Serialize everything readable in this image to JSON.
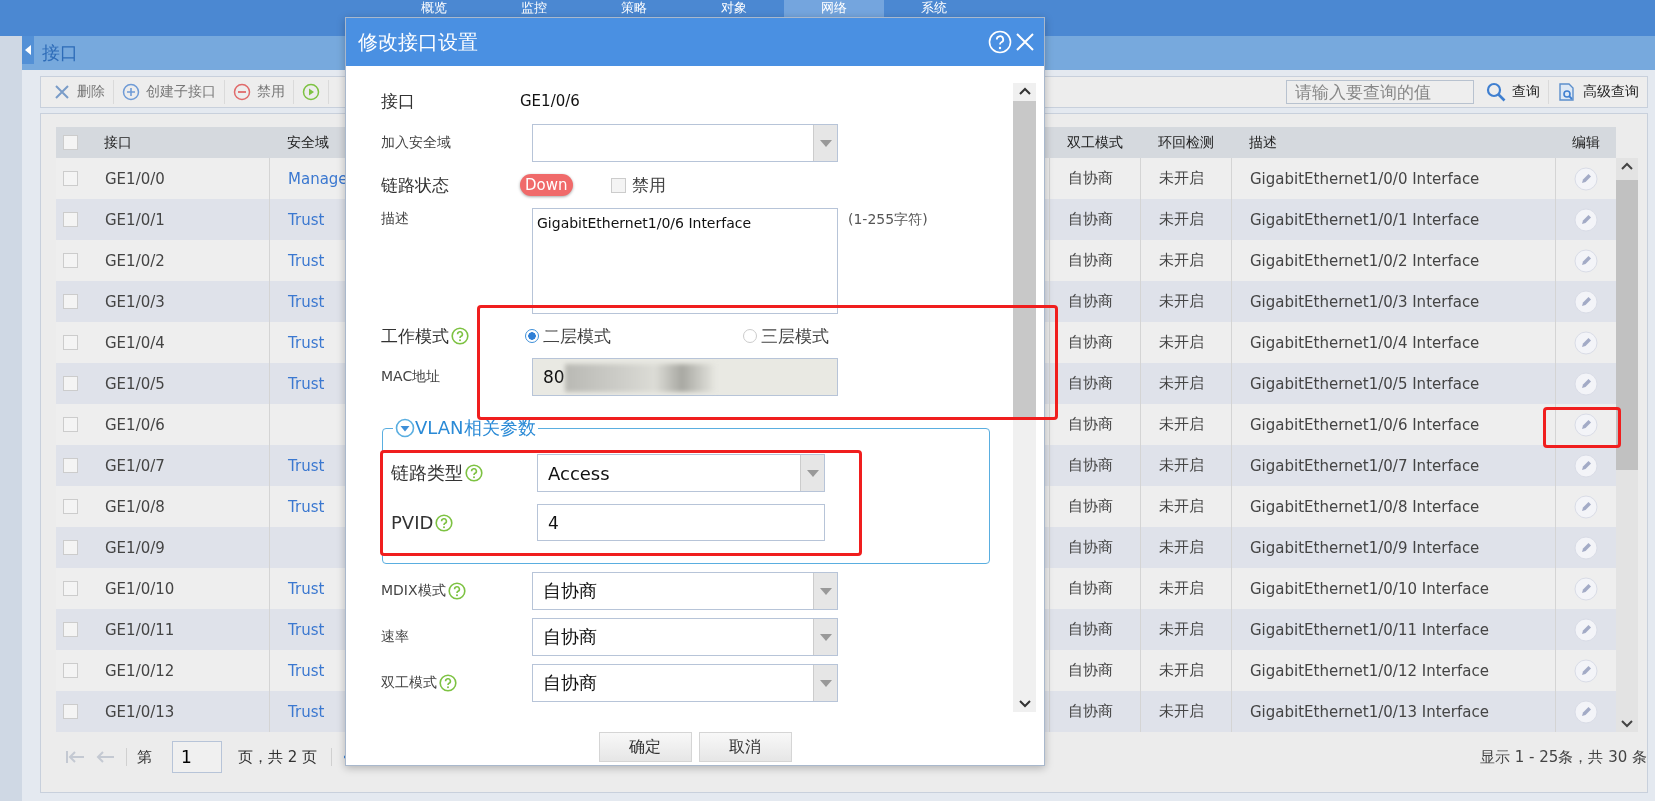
{
  "nav": {
    "tabs": [
      {
        "label": "概览",
        "selected": false
      },
      {
        "label": "监控",
        "selected": false
      },
      {
        "label": "策略",
        "selected": false
      },
      {
        "label": "对象",
        "selected": false
      },
      {
        "label": "网络",
        "selected": true
      },
      {
        "label": "系统",
        "selected": false
      }
    ]
  },
  "panel": {
    "title": "接口"
  },
  "toolbar": {
    "buttons": [
      {
        "kind": "delete",
        "label": "删除"
      },
      {
        "kind": "add",
        "label": "创建子接口"
      },
      {
        "kind": "disable",
        "label": "禁用"
      },
      {
        "kind": "enable"
      }
    ],
    "search": {
      "placeholder": "请输入要查询的值"
    },
    "search_button": "查询",
    "advanced_search_button": "高级查询"
  },
  "table": {
    "header_checked": false,
    "columns": [
      "接口",
      "安全域",
      "双工模式",
      "环回检测",
      "描述",
      "编辑"
    ],
    "rows": [
      {
        "checked": false,
        "interface": "GE1/0/0",
        "zone": "Manage",
        "duplex": "自协商",
        "loopback": "未开启",
        "description": "GigabitEthernet1/0/0 Interface"
      },
      {
        "checked": false,
        "interface": "GE1/0/1",
        "zone": "Trust",
        "duplex": "自协商",
        "loopback": "未开启",
        "description": "GigabitEthernet1/0/1 Interface"
      },
      {
        "checked": false,
        "interface": "GE1/0/2",
        "zone": "Trust",
        "duplex": "自协商",
        "loopback": "未开启",
        "description": "GigabitEthernet1/0/2 Interface"
      },
      {
        "checked": false,
        "interface": "GE1/0/3",
        "zone": "Trust",
        "duplex": "自协商",
        "loopback": "未开启",
        "description": "GigabitEthernet1/0/3 Interface"
      },
      {
        "checked": false,
        "interface": "GE1/0/4",
        "zone": "Trust",
        "duplex": "自协商",
        "loopback": "未开启",
        "description": "GigabitEthernet1/0/4 Interface"
      },
      {
        "checked": false,
        "interface": "GE1/0/5",
        "zone": "Trust",
        "duplex": "自协商",
        "loopback": "未开启",
        "description": "GigabitEthernet1/0/5 Interface"
      },
      {
        "checked": false,
        "interface": "GE1/0/6",
        "duplex": "自协商",
        "loopback": "未开启",
        "description": "GigabitEthernet1/0/6 Interface"
      },
      {
        "checked": false,
        "interface": "GE1/0/7",
        "zone": "Trust",
        "duplex": "自协商",
        "loopback": "未开启",
        "description": "GigabitEthernet1/0/7 Interface"
      },
      {
        "checked": false,
        "interface": "GE1/0/8",
        "zone": "Trust",
        "duplex": "自协商",
        "loopback": "未开启",
        "description": "GigabitEthernet1/0/8 Interface"
      },
      {
        "checked": false,
        "interface": "GE1/0/9",
        "duplex": "自协商",
        "loopback": "未开启",
        "description": "GigabitEthernet1/0/9 Interface"
      },
      {
        "checked": false,
        "interface": "GE1/0/10",
        "zone": "Trust",
        "duplex": "自协商",
        "loopback": "未开启",
        "description": "GigabitEthernet1/0/10 Interface"
      },
      {
        "checked": false,
        "interface": "GE1/0/11",
        "zone": "Trust",
        "duplex": "自协商",
        "loopback": "未开启",
        "description": "GigabitEthernet1/0/11 Interface"
      },
      {
        "checked": false,
        "interface": "GE1/0/12",
        "zone": "Trust",
        "duplex": "自协商",
        "loopback": "未开启",
        "description": "GigabitEthernet1/0/12 Interface"
      },
      {
        "checked": false,
        "interface": "GE1/0/13",
        "zone": "Trust",
        "duplex": "自协商",
        "loopback": "未开启",
        "description": "GigabitEthernet1/0/13 Interface"
      }
    ]
  },
  "pager": {
    "page_prefix": "第",
    "page": "1",
    "page_suffix": "页，共 2 页",
    "summary": "显示 1 - 25条，共 30 条"
  },
  "dialog": {
    "title": "修改接口设置",
    "fields": [
      {
        "kind": "text",
        "label": "接口",
        "help": false,
        "value": "GE1/0/6"
      },
      {
        "kind": "select",
        "label": "加入安全域",
        "help": false
      },
      {
        "kind": "status",
        "label": "链路状态",
        "help": false,
        "badge": "Down",
        "checkbox_label": "禁用",
        "checked": false
      },
      {
        "kind": "textarea",
        "label": "描述",
        "help": false,
        "value": "GigabitEthernet1/0/6 Interface",
        "hint": "(1-255字符)"
      },
      {
        "kind": "radio",
        "label": "工作模式",
        "help": true,
        "options": [
          {
            "label": "二层模式",
            "selected": true
          },
          {
            "label": "三层模式",
            "selected": false
          }
        ]
      },
      {
        "kind": "readonly",
        "label": "MAC地址",
        "help": false,
        "value": "80",
        "redacted": true
      }
    ],
    "vlan_section": {
      "title": "VLAN相关参数",
      "expanded": true,
      "fields": [
        {
          "kind": "select",
          "label": "链路类型",
          "help": true,
          "value": "Access"
        },
        {
          "kind": "input",
          "label": "PVID",
          "help": true,
          "value": "4"
        }
      ]
    },
    "more_fields": [
      {
        "kind": "select",
        "label": "MDIX模式",
        "help": true,
        "value": "自协商"
      },
      {
        "kind": "select",
        "label": "速率",
        "help": false,
        "value": "自协商"
      },
      {
        "kind": "select",
        "label": "双工模式",
        "help": true,
        "value": "自协商"
      }
    ],
    "buttons": [
      "确定",
      "取消"
    ]
  },
  "annotations": [
    {
      "kind": "mode-box"
    },
    {
      "kind": "vlan-box"
    },
    {
      "kind": "edit-box"
    }
  ]
}
